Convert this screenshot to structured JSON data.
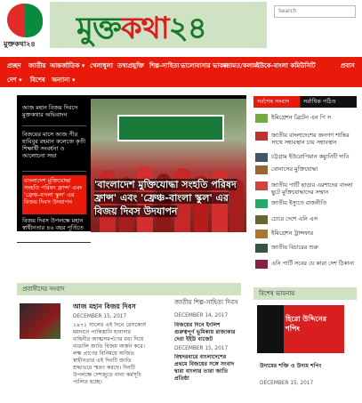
{
  "header": {
    "logo_text": "মুক্তকথা২৪",
    "title_green": "মুক্ত",
    "title_red": "কথা",
    "title_num": "২৪",
    "search_placeholder": "Search"
  },
  "nav": {
    "row1": [
      "প্রচ্ছদ",
      "জাতীয়",
      "আন্তর্জাতিক ▾",
      "খেলাধুলা",
      "তথ্যপ্রযুক্তি",
      "শিল্প-সাহিত্য",
      "ভালোবাসার ভাবনা",
      "মতামত/কলাম",
      "ইউকে-বাংলা কমিউনিটি",
      "প্রবাস"
    ],
    "row2": [
      "দেশ ▾",
      "বিশেষ",
      "অন্যান্য ▾"
    ]
  },
  "featured": {
    "list": [
      "আজ মহান বিজয় দিবসে মুক্তকথার অভিবাদন",
      "বিজয়ের মাসে আজ পীর হাবিবুর রহমান কলেজে কৃতী শিক্ষার্থী সংবর্ধনা ও আলোচনা সভা",
      "বাংলাদেশ মুক্তিযোদ্ধা সংহতি পরিষদ ফ্রান্স' এবং 'ফ্রেঞ্চ-বাংলা স্কুল' এর বিজয় দিবস উদযাপন",
      "বিজয় দিবস উপলক্ষে মহান স্বাধীনতার ৪৬ বছর পূর্তিতে আলোচনা"
    ],
    "caption": "'বাংলাদেশ মুক্তিযোদ্ধা সংহতি পরিষদ ফ্রান্স' এবং 'ফ্রেঞ্চ-বাংলা স্কুল' এর বিজয় দিবস উদযাপন"
  },
  "sidebar": {
    "tab_latest": "সর্বশেষ সংবাদ",
    "tab_popular": "সর্বাধিক পঠিত",
    "items": [
      "ইমিগ্রেশন ব্রিটেন এন পি স",
      "জাতীয় বাংলাদেশের জনগণ শান্তির সাথে সহাবস্থান চায় সহাবস্থান",
      "চট্টগ্রাম ইউরোপিয়ান কম্যুনিটি দাবি",
      "বোনাসের মুক্তিযোদ্ধা",
      "জাতীয় পার্টি ছাড়ার এরশাদের বাংলা ছুটে মুক্তিযোদ্ধাদের সম্মান",
      "জাতীয় ইস্যুতে রাজনীতি",
      "চোরে দেশে এনি এস",
      "ইমিগ্রেশন ট্রান্সফার",
      "জাতীয় বিচারের শুরু",
      "এনি পার্টি সবের যে কারা দেশ ঠিকানা"
    ]
  },
  "bottom": {
    "left": {
      "section": "প্রবাসীদের সংবাদ",
      "headline": "আজ মহান বিজয় দিবস",
      "date": "DECEMBER 15, 2017",
      "excerpt": "১৯৭১ সালের এই দিনে রেসকোর্স ময়দানে পাকিস্তানি হানাদার বাহিনীর আত্মসমর্পণের মধ্য দিয়ে বাঙালি জাতি বিজয় অর্জন করে। লক্ষ প্রাণের বিনিময়ে অর্জিত স্বাধীনতার এই দিনটি জাতি শ্রদ্ধাভরে স্মরণ করছে। দিনটি উপলক্ষে দেশজুড়ে নানা কর্মসূচি পালিত হচ্ছে।"
    },
    "middle": {
      "section": "জাতীয় শিল্প-সাহিত্য দিবস",
      "date1": "DECEMBER 14, 2017",
      "item1": "বিজয়ের দিনে ইংলিশ গুরুত্বপূর্ণ ভূমিকায় রাজাকার দেরা ইইউ বাজেট",
      "date2": "DECEMBER 15, 2017",
      "item2": "বিশ্বদরবারে বাংলাদেশের প্রথমে বিজয়ের সঙ্গে সংবাদ দ্বারা বাংলার তারা জাতি প্রতিষ্ঠা"
    },
    "right": {
      "section": "বিশেষ ভাবনায়",
      "img_text": "হিরো উদ্দিনের শপিং",
      "headline": "উদ্যমের শক্তি ও উদ্যম শপিং",
      "date": "DECEMBER 15, 2017"
    }
  }
}
